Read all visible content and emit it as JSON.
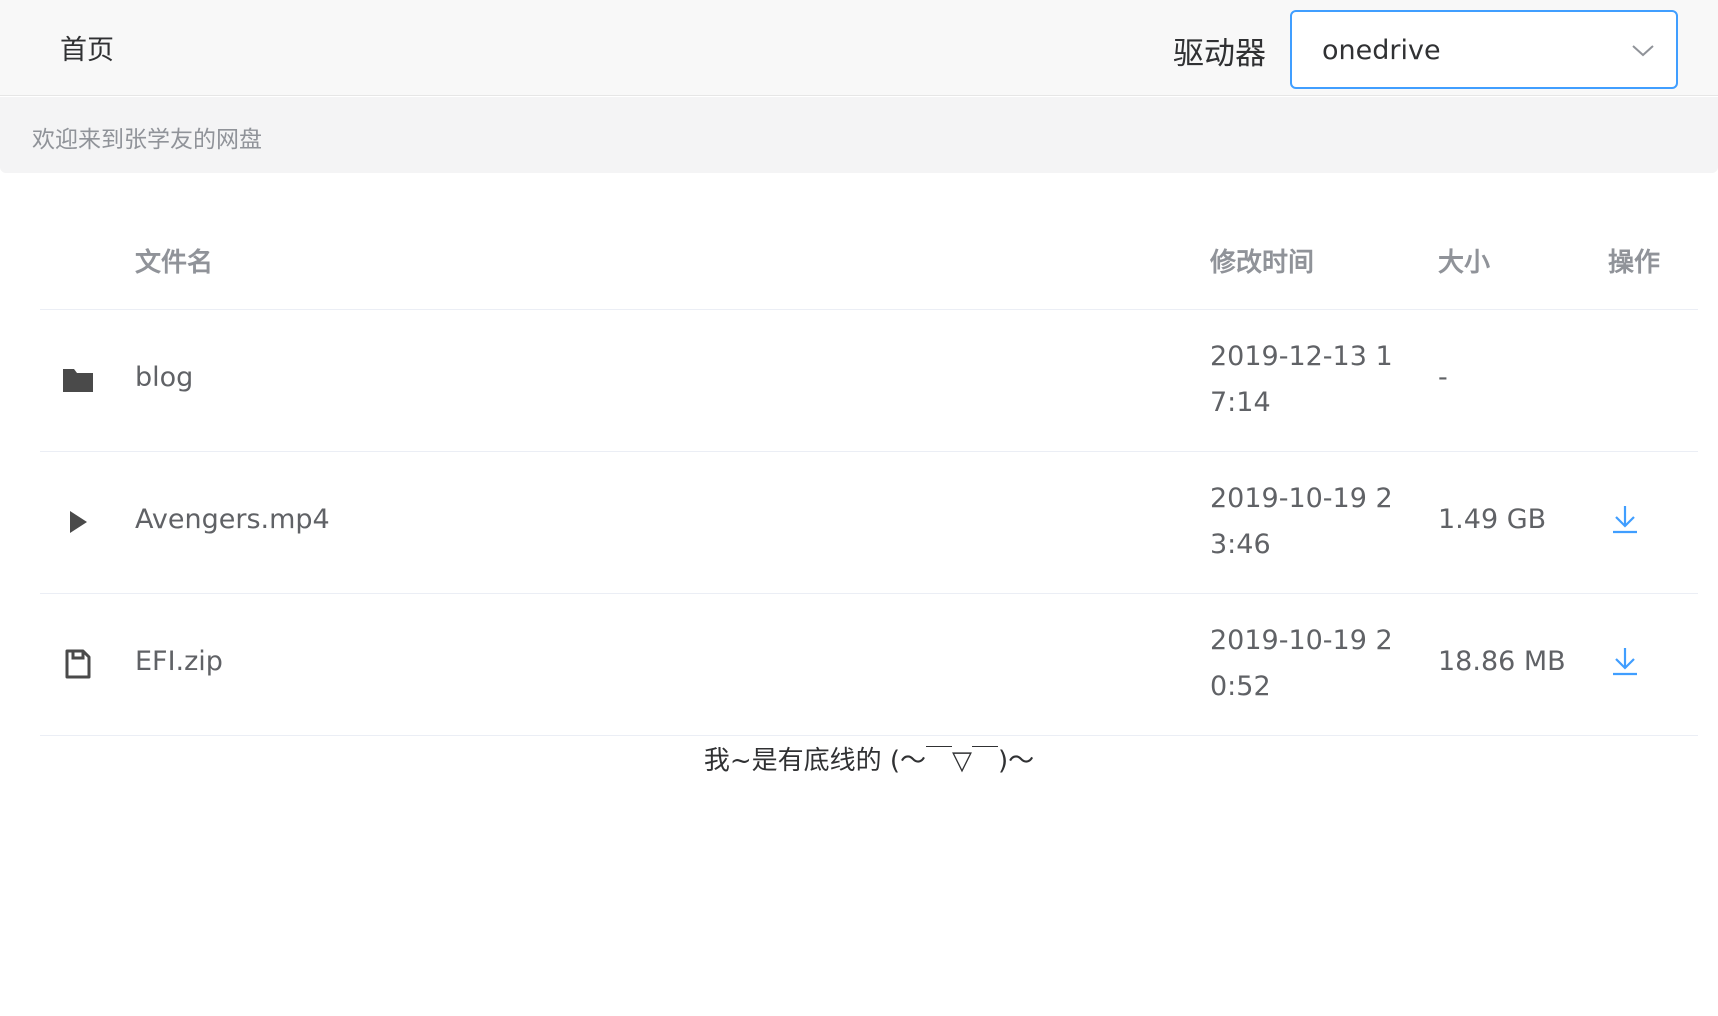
{
  "header": {
    "home_label": "首页",
    "drive_label": "驱动器",
    "drive_selected": "onedrive"
  },
  "welcome_text": "欢迎来到张学友的网盘",
  "table": {
    "columns": {
      "name": "文件名",
      "modified": "修改时间",
      "size": "大小",
      "actions": "操作"
    },
    "rows": [
      {
        "icon": "folder-icon",
        "name": "blog",
        "modified": "2019-12-13 17:14",
        "size": "-"
      },
      {
        "icon": "play-icon",
        "name": "Avengers.mp4",
        "modified": "2019-10-19 23:46",
        "size": "1.49 GB"
      },
      {
        "icon": "file-icon",
        "name": "EFI.zip",
        "modified": "2019-10-19 20:52",
        "size": "18.86 MB"
      }
    ]
  },
  "footer_text": "我~是有底线的 (～￣▽￣)～",
  "colors": {
    "accent": "#409eff",
    "icon": "#4a4a4a",
    "header_bg": "#f8f8f8",
    "welcome_bg": "#f4f4f5"
  }
}
